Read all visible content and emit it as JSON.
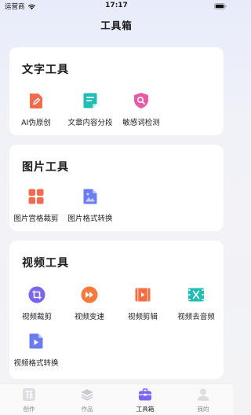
{
  "status_bar": {
    "carrier": "运营商",
    "time": "17:17"
  },
  "header": {
    "title": "工具箱"
  },
  "sections": [
    {
      "title": "文字工具",
      "tools": [
        {
          "label": "AI伪原创",
          "icon": "pencil-doc-icon",
          "color": "#f36b4c"
        },
        {
          "label": "文章内容分段",
          "icon": "list-doc-icon",
          "color": "#1fbdb3"
        },
        {
          "label": "敏感词检测",
          "icon": "shield-search-icon",
          "color": "#e95aa6"
        }
      ]
    },
    {
      "title": "图片工具",
      "tools": [
        {
          "label": "图片宫格裁剪",
          "icon": "grid-icon",
          "color": "#f46a4e"
        },
        {
          "label": "图片格式转换",
          "icon": "image-icon",
          "color": "#6b7cf0"
        }
      ]
    },
    {
      "title": "视频工具",
      "tools": [
        {
          "label": "视频裁剪",
          "icon": "crop-icon",
          "color": "#7b64f0"
        },
        {
          "label": "视频变速",
          "icon": "fast-forward-icon",
          "color": "#f47a3b"
        },
        {
          "label": "视频剪辑",
          "icon": "film-icon",
          "color": "#f46d45"
        },
        {
          "label": "视频去音频",
          "icon": "film-mute-icon",
          "color": "#1fbdb3"
        },
        {
          "label": "视频格式转换",
          "icon": "video-doc-icon",
          "color": "#6b7cf0"
        }
      ]
    }
  ],
  "tab_bar": {
    "tabs": [
      {
        "label": "创作",
        "icon": "create-icon",
        "active": false
      },
      {
        "label": "作品",
        "icon": "layers-icon",
        "active": false
      },
      {
        "label": "工具箱",
        "icon": "toolbox-icon",
        "active": true
      },
      {
        "label": "我的",
        "icon": "user-icon",
        "active": false
      }
    ]
  },
  "colors": {
    "accent": "#7b64f0",
    "inactive_tab": "#c9c9cf"
  }
}
